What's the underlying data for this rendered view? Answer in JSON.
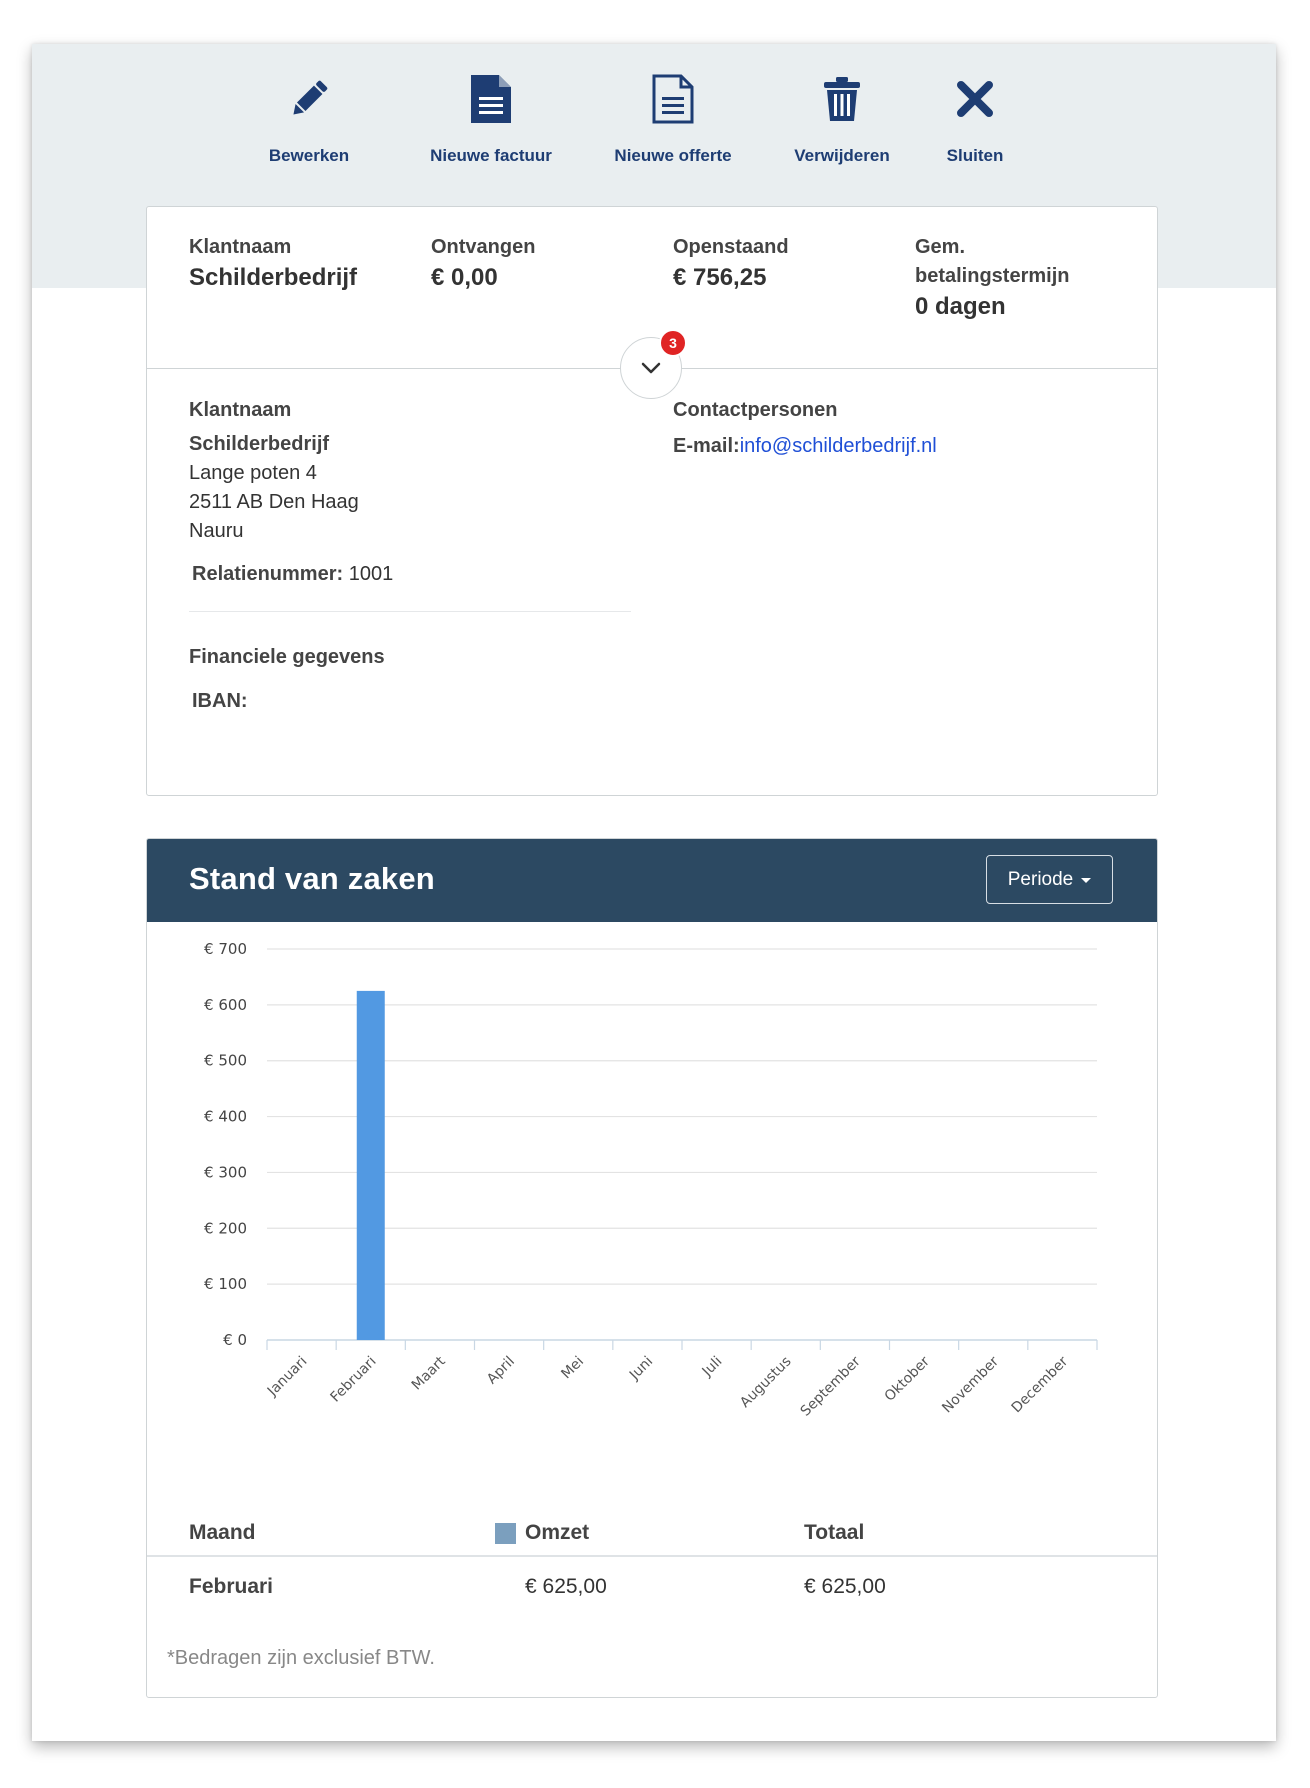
{
  "toolbar": {
    "items": [
      {
        "label": "Bewerken",
        "icon": "pencil-icon"
      },
      {
        "label": "Nieuwe factuur",
        "icon": "invoice-filled-icon"
      },
      {
        "label": "Nieuwe offerte",
        "icon": "quote-outline-icon"
      },
      {
        "label": "Verwijderen",
        "icon": "trash-icon"
      },
      {
        "label": "Sluiten",
        "icon": "close-icon"
      }
    ]
  },
  "summary": {
    "klantnaam_label": "Klantnaam",
    "klantnaam_value": "Schilderbedrijf",
    "ontvangen_label": "Ontvangen",
    "ontvangen_value": "€ 0,00",
    "openstaand_label": "Openstaand",
    "openstaand_value": "€ 756,25",
    "termijn_label_1": "Gem.",
    "termijn_label_2": "betalingstermijn",
    "termijn_value": "0 dagen",
    "badge_count": "3"
  },
  "details": {
    "klantnaam_label": "Klantnaam",
    "name": "Schilderbedrijf",
    "street": "Lange poten 4",
    "city": "2511 AB Den Haag",
    "country": "Nauru",
    "relatie_label": "Relatienummer:",
    "relatie_value": "1001",
    "financieel_label": "Financiele gegevens",
    "iban_label": "IBAN:",
    "contact_label": "Contactpersonen",
    "email_label": "E-mail:",
    "email_value": "info@schilderbedrijf.nl"
  },
  "stand": {
    "title": "Stand van zaken",
    "periode_label": "Periode"
  },
  "chart_data": {
    "type": "bar",
    "categories": [
      "Januari",
      "Februari",
      "Maart",
      "April",
      "Mei",
      "Juni",
      "Juli",
      "Augustus",
      "September",
      "Oktober",
      "November",
      "December"
    ],
    "series": [
      {
        "name": "Omzet",
        "values": [
          0,
          625,
          0,
          0,
          0,
          0,
          0,
          0,
          0,
          0,
          0,
          0
        ]
      }
    ],
    "yticks": [
      "€ 0",
      "€ 100",
      "€ 200",
      "€ 300",
      "€ 400",
      "€ 500",
      "€ 600",
      "€ 700"
    ],
    "ylim": [
      0,
      700
    ],
    "grid": true,
    "bar_color": "#5299e2"
  },
  "table": {
    "headers": {
      "maand": "Maand",
      "omzet": "Omzet",
      "totaal": "Totaal"
    },
    "rows": [
      {
        "maand": "Februari",
        "omzet": "€ 625,00",
        "totaal": "€ 625,00"
      }
    ]
  },
  "note": "*Bedragen zijn exclusief BTW.",
  "colors": {
    "header_bg": "#2c4962",
    "toolbar_text": "#1e3d73",
    "link": "#1f4fd6",
    "badge": "#e02424"
  }
}
